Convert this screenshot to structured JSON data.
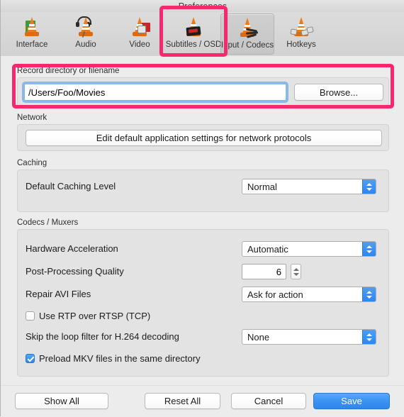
{
  "window": {
    "title": "Preferences"
  },
  "toolbar": {
    "items": [
      {
        "label": "Interface",
        "icon": "vlc-cone-interface-icon",
        "selected": false
      },
      {
        "label": "Audio",
        "icon": "vlc-cone-audio-icon",
        "selected": false
      },
      {
        "label": "Video",
        "icon": "vlc-cone-video-icon",
        "selected": false
      },
      {
        "label": "Subtitles / OSD",
        "icon": "vlc-cone-subtitles-icon",
        "selected": false
      },
      {
        "label": "Input / Codecs",
        "icon": "vlc-cone-input-codecs-icon",
        "selected": true
      },
      {
        "label": "Hotkeys",
        "icon": "vlc-cone-hotkeys-icon",
        "selected": false
      }
    ]
  },
  "record_section": {
    "title": "Record directory or filename",
    "path_value": "/Users/Foo/Movies",
    "browse_label": "Browse..."
  },
  "network_section": {
    "title": "Network",
    "edit_button_label": "Edit default application settings for network protocols"
  },
  "caching_section": {
    "title": "Caching",
    "level_label": "Default Caching Level",
    "level_value": "Normal"
  },
  "codecs_section": {
    "title": "Codecs / Muxers",
    "hardware_acceleration_label": "Hardware Acceleration",
    "hardware_acceleration_value": "Automatic",
    "post_processing_label": "Post-Processing Quality",
    "post_processing_value": "6",
    "repair_avi_label": "Repair AVI Files",
    "repair_avi_value": "Ask for action",
    "rtp_checkbox_label": "Use RTP over RTSP (TCP)",
    "rtp_checked": false,
    "loop_filter_label": "Skip the loop filter for H.264 decoding",
    "loop_filter_value": "None",
    "preload_mkv_label": "Preload MKV files in the same directory",
    "preload_mkv_checked": true
  },
  "footer": {
    "show_all_label": "Show All",
    "reset_all_label": "Reset All",
    "cancel_label": "Cancel",
    "save_label": "Save"
  },
  "annotations": {
    "highlight_color": "#f7286b"
  }
}
